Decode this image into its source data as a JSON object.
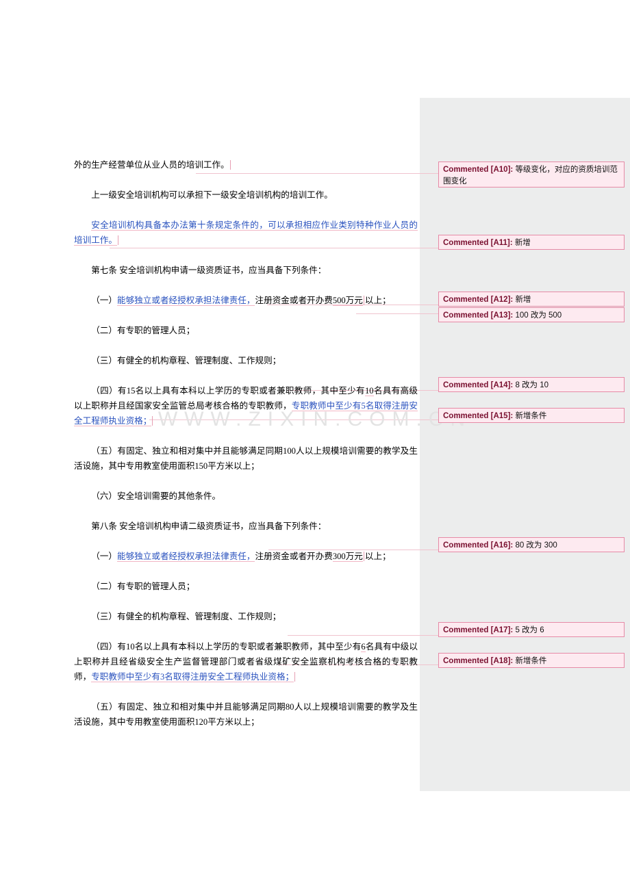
{
  "document": {
    "paragraphs": [
      {
        "id": "p1",
        "text": "外的生产经营单位从业人员的培训工作。",
        "style": "plain"
      },
      {
        "id": "p2",
        "text": "上一级安全培训机构可以承担下一级安全培训机构的培训工作。",
        "style": "indent"
      },
      {
        "id": "p3",
        "text": "安全培训机构具备本办法第十条规定条件的，可以承担相应作业类别特种作业人员的培训工作。",
        "style": "indent-blue"
      },
      {
        "id": "p4",
        "text": "第七条  安全培训机构申请一级资质证书，应当具备下列条件：",
        "style": "indent"
      },
      {
        "id": "p5",
        "prefix": "（一）",
        "blue1": "能够独立或者经授权承担法律责任，",
        "mid": "注册资金或者开办费",
        "num": "500万元",
        "suffix": "以上；",
        "style": "indent-mixed"
      },
      {
        "id": "p6",
        "text": "（二）有专职的管理人员；",
        "style": "indent"
      },
      {
        "id": "p7",
        "text": "（三）有健全的机构章程、管理制度、工作规则；",
        "style": "indent"
      },
      {
        "id": "p8",
        "part1": "（四）有15名以上具有本科以上学历的专职或者兼职教师，其中至少有",
        "num": "10",
        "part2": "名具有高级以上职称并且经国家安全监管总局考核合格的专职教师，",
        "blue": "专职教师中至少有5名取得注册安全工程师执业资格；",
        "style": "indent-mixed2"
      },
      {
        "id": "p9",
        "text": "（五）有固定、独立和相对集中并且能够满足同期100人以上规模培训需要的教学及生活设施，其中专用教室使用面积150平方米以上；",
        "style": "indent"
      },
      {
        "id": "p10",
        "text": "（六）安全培训需要的其他条件。",
        "style": "indent"
      },
      {
        "id": "p11",
        "text": "第八条  安全培训机构申请二级资质证书，应当具备下列条件：",
        "style": "indent"
      },
      {
        "id": "p12",
        "prefix": "（一）",
        "blue1": "能够独立或者经授权承担法律责任，",
        "mid": "注册资金或者开办费",
        "num": "300万元",
        "suffix": "以上；",
        "style": "indent-mixed"
      },
      {
        "id": "p13",
        "text": "（二）有专职的管理人员；",
        "style": "indent"
      },
      {
        "id": "p14",
        "text": "（三）有健全的机构章程、管理制度、工作规则；",
        "style": "indent"
      },
      {
        "id": "p15",
        "part1": "（四）有10名以上具有本科以上学历的专职或者兼职教师，其中至少有",
        "num": "6",
        "part2": "名具有中级以上职称并且经省级安全生产监督管理部门或者省级煤矿安全监察机构考核合格的专职教师，",
        "blue": "专职教师中至少有3名取得注册安全工程师执业资格；",
        "style": "indent-mixed2"
      },
      {
        "id": "p16",
        "text": "（五）有固定、独立和相对集中并且能够满足同期80人以上规模培训需要的教学及生活设施，其中专用教室使用面积120平方米以上；",
        "style": "indent"
      }
    ]
  },
  "comments": [
    {
      "id": "c10",
      "tag": "Commented [A10]:",
      "body": "等级变化，对应的资质培训范围变化"
    },
    {
      "id": "c11",
      "tag": "Commented [A11]:",
      "body": "新增"
    },
    {
      "id": "c12",
      "tag": "Commented [A12]:",
      "body": "新增"
    },
    {
      "id": "c13",
      "tag": "Commented [A13]:",
      "body": "100 改为 500"
    },
    {
      "id": "c14",
      "tag": "Commented [A14]:",
      "body": "8 改为 10"
    },
    {
      "id": "c15",
      "tag": "Commented [A15]:",
      "body": "新增条件"
    },
    {
      "id": "c16",
      "tag": "Commented [A16]:",
      "body": "80 改为 300"
    },
    {
      "id": "c17",
      "tag": "Commented [A17]:",
      "body": "5 改为 6"
    },
    {
      "id": "c18",
      "tag": "Commented [A18]:",
      "body": "新增条件"
    }
  ],
  "watermark": {
    "text": "WWW.ZIXIN.COM.CN"
  }
}
